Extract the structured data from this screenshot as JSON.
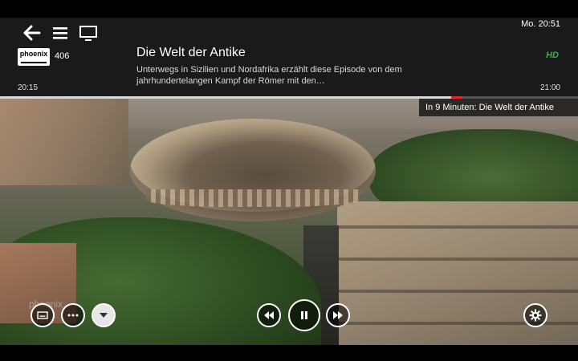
{
  "header": {
    "clock": "Mo. 20:51",
    "hd_badge": "HD"
  },
  "channel": {
    "logo_text": "phoenix",
    "number": "406"
  },
  "program": {
    "title": "Die Welt der Antike",
    "description": "Unterwegs in Sizilien und Nordafrika erzählt diese Episode von dem jahrhundertelangen Kampf der Römer mit den…",
    "start_time": "20:15",
    "end_time": "21:00",
    "progress_fraction": 0.8,
    "next_notice": "In 9 Minuten: Die Welt der Antike"
  },
  "watermark": "phoenix",
  "icons": {
    "back": "arrow-left-icon",
    "menu": "hamburger-menu-icon",
    "screen": "tv-screen-icon",
    "subtitles": "subtitles-icon",
    "more": "more-options-icon",
    "expand": "chevron-down-icon",
    "rewind": "rewind-icon",
    "pause": "pause-icon",
    "forward": "fast-forward-icon",
    "settings": "gear-icon"
  },
  "colors": {
    "overlay": "#1e1e1e",
    "hd_green": "#38b24a",
    "progress_marker": "#e0262a"
  }
}
